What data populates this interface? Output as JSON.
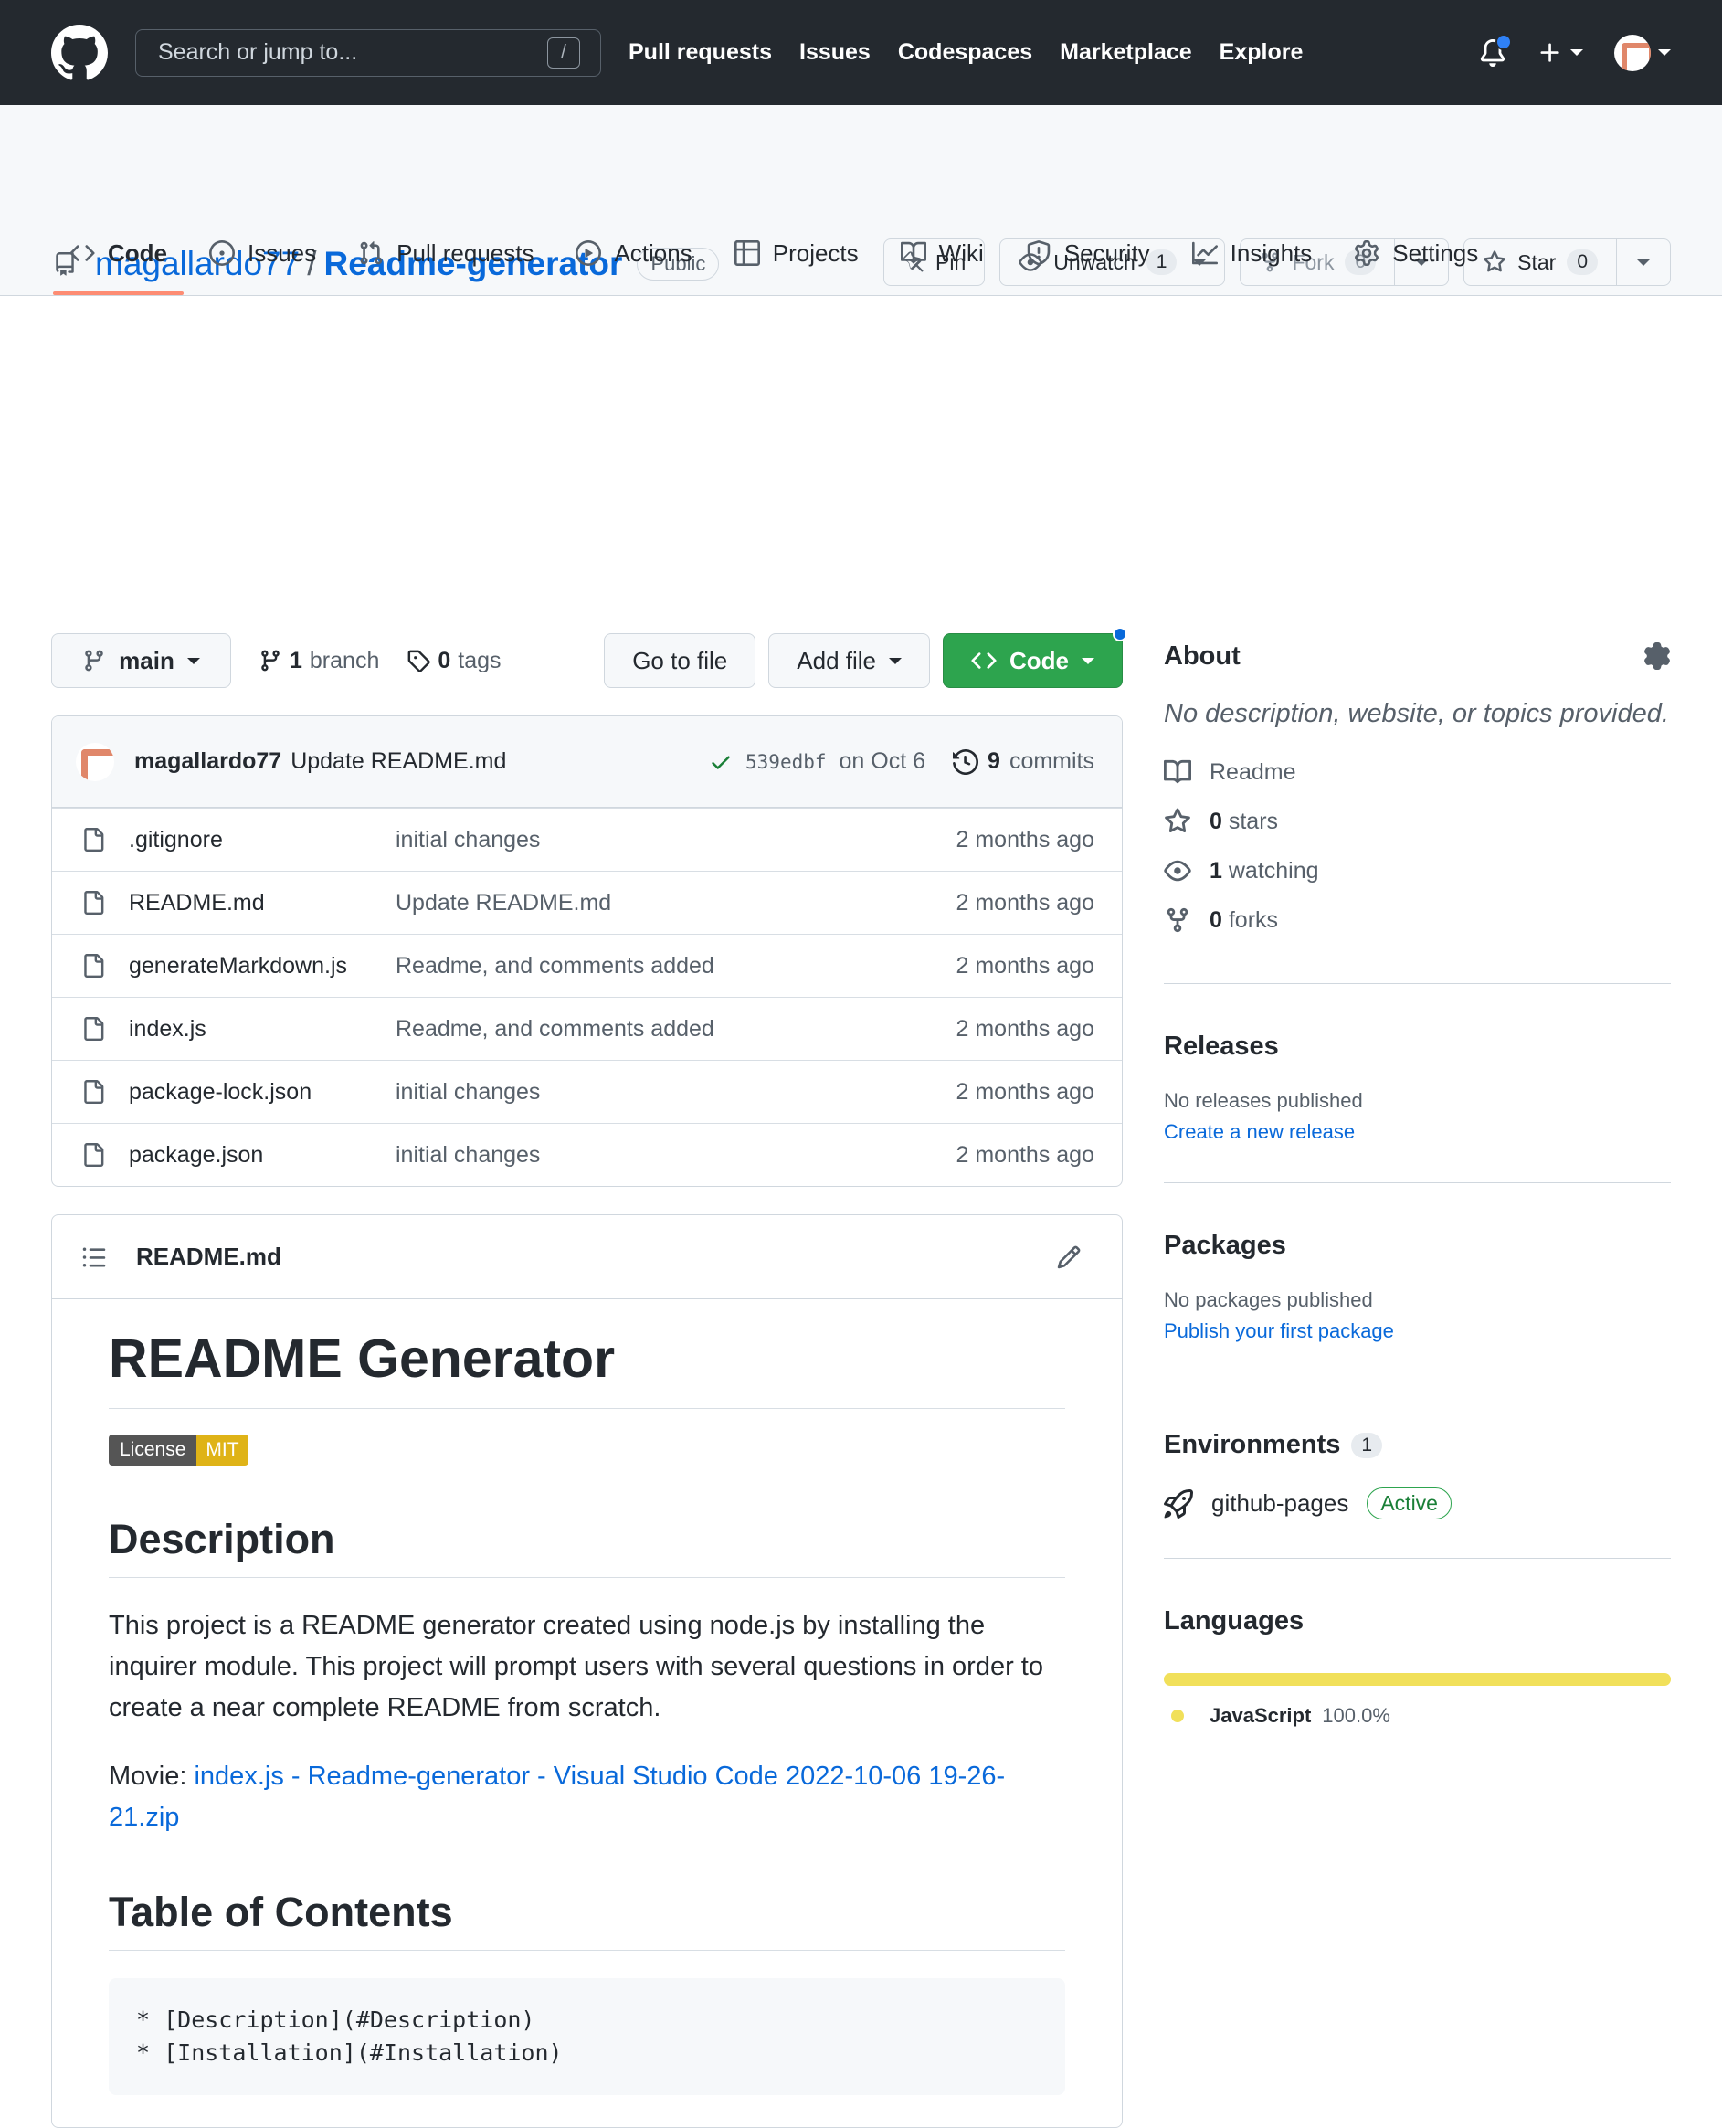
{
  "header": {
    "search_placeholder": "Search or jump to...",
    "search_shortcut": "/",
    "nav": [
      "Pull requests",
      "Issues",
      "Codespaces",
      "Marketplace",
      "Explore"
    ]
  },
  "repo": {
    "owner": "magallardo77",
    "separator": "/",
    "name": "Readme-generator",
    "visibility": "Public",
    "pin_label": "Pin",
    "unwatch_label": "Unwatch",
    "watch_count": "1",
    "fork_label": "Fork",
    "fork_count": "0",
    "star_label": "Star",
    "star_count": "0"
  },
  "tabs": [
    "Code",
    "Issues",
    "Pull requests",
    "Actions",
    "Projects",
    "Wiki",
    "Security",
    "Insights",
    "Settings"
  ],
  "branchbar": {
    "branch": "main",
    "branch_count": "1",
    "branch_label": "branch",
    "tag_count": "0",
    "tag_label": "tags",
    "goto_file": "Go to file",
    "add_file": "Add file",
    "code": "Code"
  },
  "commit": {
    "author": "magallardo77",
    "message": "Update README.md",
    "sha": "539edbf",
    "date": "on Oct 6",
    "count": "9",
    "count_label": "commits"
  },
  "files": [
    {
      "name": ".gitignore",
      "message": "initial changes",
      "age": "2 months ago"
    },
    {
      "name": "README.md",
      "message": "Update README.md",
      "age": "2 months ago"
    },
    {
      "name": "generateMarkdown.js",
      "message": "Readme, and comments added",
      "age": "2 months ago"
    },
    {
      "name": "index.js",
      "message": "Readme, and comments added",
      "age": "2 months ago"
    },
    {
      "name": "package-lock.json",
      "message": "initial changes",
      "age": "2 months ago"
    },
    {
      "name": "package.json",
      "message": "initial changes",
      "age": "2 months ago"
    }
  ],
  "readme": {
    "filename": "README.md",
    "h1": "README Generator",
    "badge_left": "License",
    "badge_right": "MIT",
    "h2_description": "Description",
    "description": "This project is a README generator created using node.js by installing the inquirer module. This project will prompt users with several questions in order to create a near complete README from scratch.",
    "movie_label": "Movie: ",
    "movie_link": "index.js - Readme-generator - Visual Studio Code 2022-10-06 19-26-21.zip",
    "h2_toc": "Table of Contents",
    "code_lines": [
      "* [Description](#Description)",
      "* [Installation](#Installation)"
    ]
  },
  "sidebar": {
    "about_title": "About",
    "no_description": "No description, website, or topics provided.",
    "readme_label": "Readme",
    "stars_count": "0",
    "stars_label": "stars",
    "watching_count": "1",
    "watching_label": "watching",
    "forks_count": "0",
    "forks_label": "forks",
    "releases_title": "Releases",
    "releases_none": "No releases published",
    "releases_link": "Create a new release",
    "packages_title": "Packages",
    "packages_none": "No packages published",
    "packages_link": "Publish your first package",
    "environments_title": "Environments",
    "environments_count": "1",
    "env_name": "github-pages",
    "env_status": "Active",
    "languages_title": "Languages",
    "language_name": "JavaScript",
    "language_pct": "100.0%",
    "language_color": "#f1e05a"
  }
}
